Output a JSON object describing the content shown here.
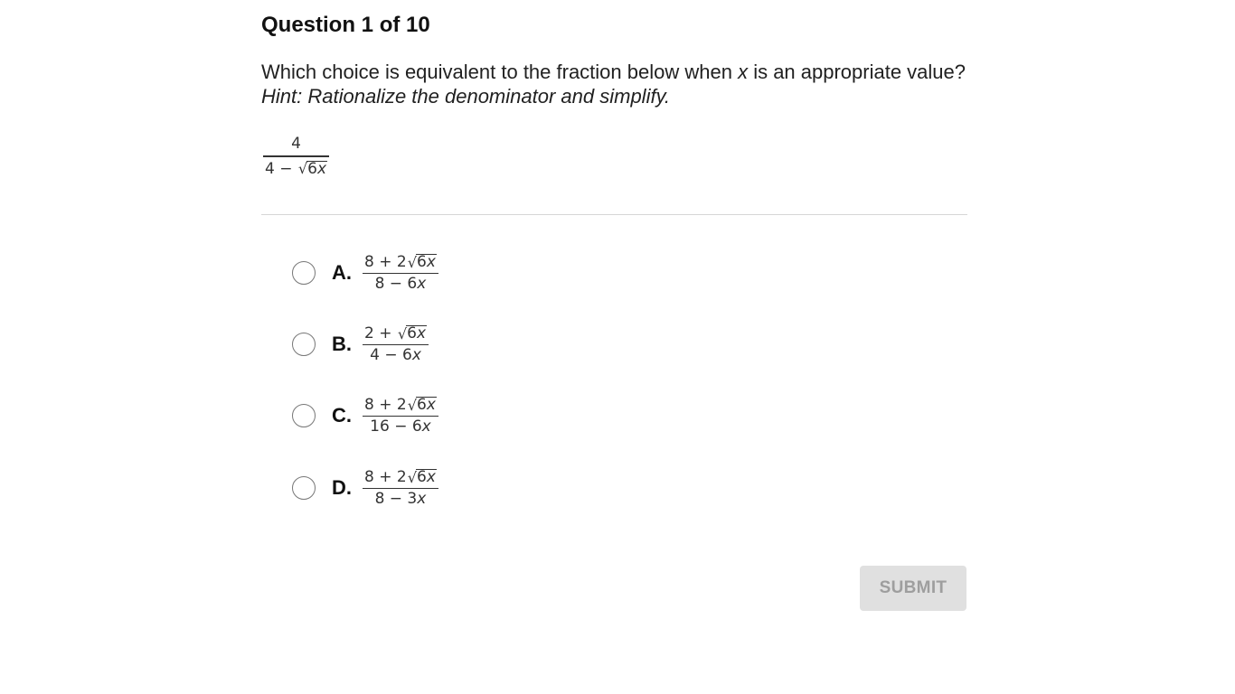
{
  "question": {
    "title": "Question 1 of 10",
    "prompt_before": "Which choice is equivalent to the fraction below when ",
    "prompt_var": "x",
    "prompt_after": " is an appropriate value? ",
    "prompt_hint": "Hint: Rationalize the denominator and simplify.",
    "fraction": {
      "numerator": "4",
      "denominator_prefix": "4 − ",
      "radicand": "6",
      "radicand_var": "x"
    }
  },
  "options": [
    {
      "letter": "A.",
      "num_prefix": "8 + 2",
      "num_radicand": "6",
      "num_var": "x",
      "den_prefix": "8 − 6",
      "den_var": "x"
    },
    {
      "letter": "B.",
      "num_prefix": "2 + ",
      "num_radicand": "6",
      "num_var": "x",
      "den_prefix": "4 − 6",
      "den_var": "x"
    },
    {
      "letter": "C.",
      "num_prefix": "8 + 2",
      "num_radicand": "6",
      "num_var": "x",
      "den_prefix": "16 − 6",
      "den_var": "x"
    },
    {
      "letter": "D.",
      "num_prefix": "8 + 2",
      "num_radicand": "6",
      "num_var": "x",
      "den_prefix": "8 − 3",
      "den_var": "x"
    }
  ],
  "submit": {
    "label": "SUBMIT",
    "enabled": false
  },
  "colors": {
    "submit_bg": "#e0e0e0",
    "submit_text": "#9e9e9e",
    "divider": "#d6d6d6"
  }
}
